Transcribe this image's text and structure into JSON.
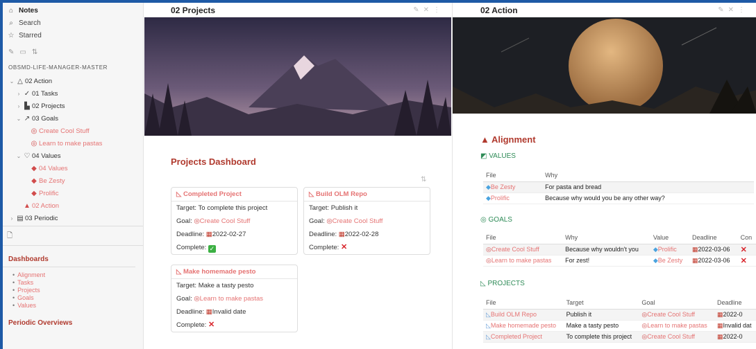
{
  "sidebar": {
    "nav": [
      {
        "label": "Notes",
        "icon": "home-icon"
      },
      {
        "label": "Search",
        "icon": "search-icon"
      },
      {
        "label": "Starred",
        "icon": "star-icon"
      }
    ],
    "vault_name": "OBSMD-LIFE-MANAGER-MASTER",
    "tree": [
      {
        "label": "02 Action",
        "chev": "⌄",
        "icon": "△",
        "indent": 0,
        "link": false
      },
      {
        "label": "01 Tasks",
        "chev": "›",
        "icon": "✓",
        "indent": 1,
        "link": false
      },
      {
        "label": "02 Projects",
        "chev": "›",
        "icon": "▙",
        "indent": 1,
        "link": false
      },
      {
        "label": "03 Goals",
        "chev": "⌄",
        "icon": "↗",
        "indent": 1,
        "link": false
      },
      {
        "label": "Create Cool Stuff",
        "chev": "",
        "icon": "◎",
        "indent": 2,
        "link": true
      },
      {
        "label": "Learn to make pastas",
        "chev": "",
        "icon": "◎",
        "indent": 2,
        "link": true
      },
      {
        "label": "04 Values",
        "chev": "⌄",
        "icon": "♡",
        "indent": 1,
        "link": false
      },
      {
        "label": "04 Values",
        "chev": "",
        "icon": "◆",
        "indent": 2,
        "link": true
      },
      {
        "label": "Be Zesty",
        "chev": "",
        "icon": "◆",
        "indent": 2,
        "link": true
      },
      {
        "label": "Prolific",
        "chev": "",
        "icon": "◆",
        "indent": 2,
        "link": true
      },
      {
        "label": "02 Action",
        "chev": "",
        "icon": "▲",
        "indent": 1,
        "link": true
      },
      {
        "label": "03 Periodic",
        "chev": "›",
        "icon": "▤",
        "indent": 0,
        "link": false
      }
    ],
    "dashboards_title": "Dashboards",
    "dashboards": [
      "Alignment",
      "Tasks",
      "Projects",
      "Goals",
      "Values"
    ],
    "periodic_title": "Periodic Overviews"
  },
  "center": {
    "title": "02 Projects",
    "heading": "Projects Dashboard",
    "labels": {
      "target": "Target: ",
      "goal": "Goal: ",
      "deadline": "Deadline: ",
      "complete": "Complete: "
    },
    "cards": [
      {
        "title": "Completed Project",
        "target": "To complete this project",
        "goal": "Create Cool Stuff",
        "deadline": "2022-02-27",
        "complete": true
      },
      {
        "title": "Build OLM Repo",
        "target": "Publish it",
        "goal": "Create Cool Stuff",
        "deadline": "2022-02-28",
        "complete": false
      },
      {
        "title": "Make homemade pesto",
        "target": "Make a tasty pesto",
        "goal": "Learn to make pastas",
        "deadline": "Invalid date",
        "complete": false
      }
    ]
  },
  "right": {
    "title": "02 Action",
    "heading": "Alignment",
    "values": {
      "title": "VALUES",
      "headers": [
        "File",
        "Why"
      ],
      "rows": [
        [
          "Be Zesty",
          "For pasta and bread"
        ],
        [
          "Prolific",
          "Because why would you be any other way?"
        ]
      ]
    },
    "goals": {
      "title": "GOALS",
      "headers": [
        "File",
        "Why",
        "Value",
        "Deadline",
        "Con"
      ],
      "rows": [
        [
          "Create Cool Stuff",
          "Because why wouldn't you",
          "Prolific",
          "2022-03-06"
        ],
        [
          "Learn to make pastas",
          "For zest!",
          "Be Zesty",
          "2022-03-06"
        ]
      ]
    },
    "projects": {
      "title": "PROJECTS",
      "headers": [
        "File",
        "Target",
        "Goal",
        "Deadline"
      ],
      "rows": [
        [
          "Build OLM Repo",
          "Publish it",
          "Create Cool Stuff",
          "2022-0"
        ],
        [
          "Make homemade pesto",
          "Make a tasty pesto",
          "Learn to make pastas",
          "Invalid dat"
        ],
        [
          "Completed Project",
          "To complete this project",
          "Create Cool Stuff",
          "2022-0"
        ]
      ]
    }
  },
  "colors": {
    "accent": "#b03a2e",
    "link": "#e57373",
    "frame": "#1e5aa6"
  }
}
